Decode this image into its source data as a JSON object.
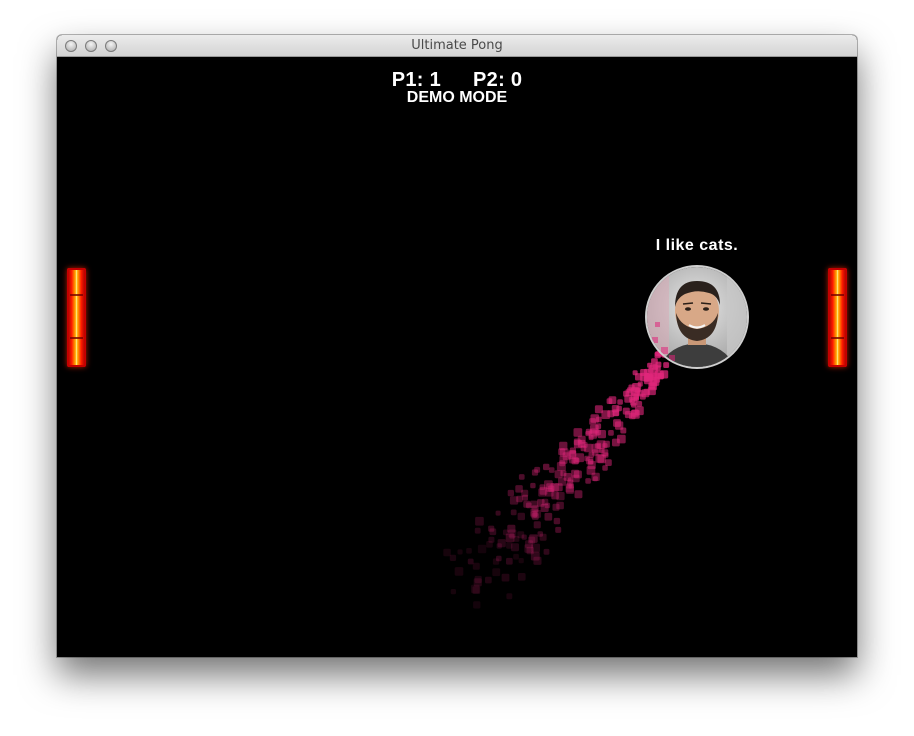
{
  "window": {
    "title": "Ultimate Pong"
  },
  "hud": {
    "p1_score": "P1: 1",
    "p2_score": "P2: 0",
    "mode": "DEMO MODE"
  },
  "ball": {
    "speech": "I like cats."
  },
  "colors": {
    "background": "#000000",
    "paddle": "#ff2200",
    "trail": "#e0267a",
    "text": "#ffffff"
  },
  "icons": {
    "close": "traffic-light-close",
    "minimize": "traffic-light-minimize",
    "zoom": "traffic-light-zoom"
  }
}
